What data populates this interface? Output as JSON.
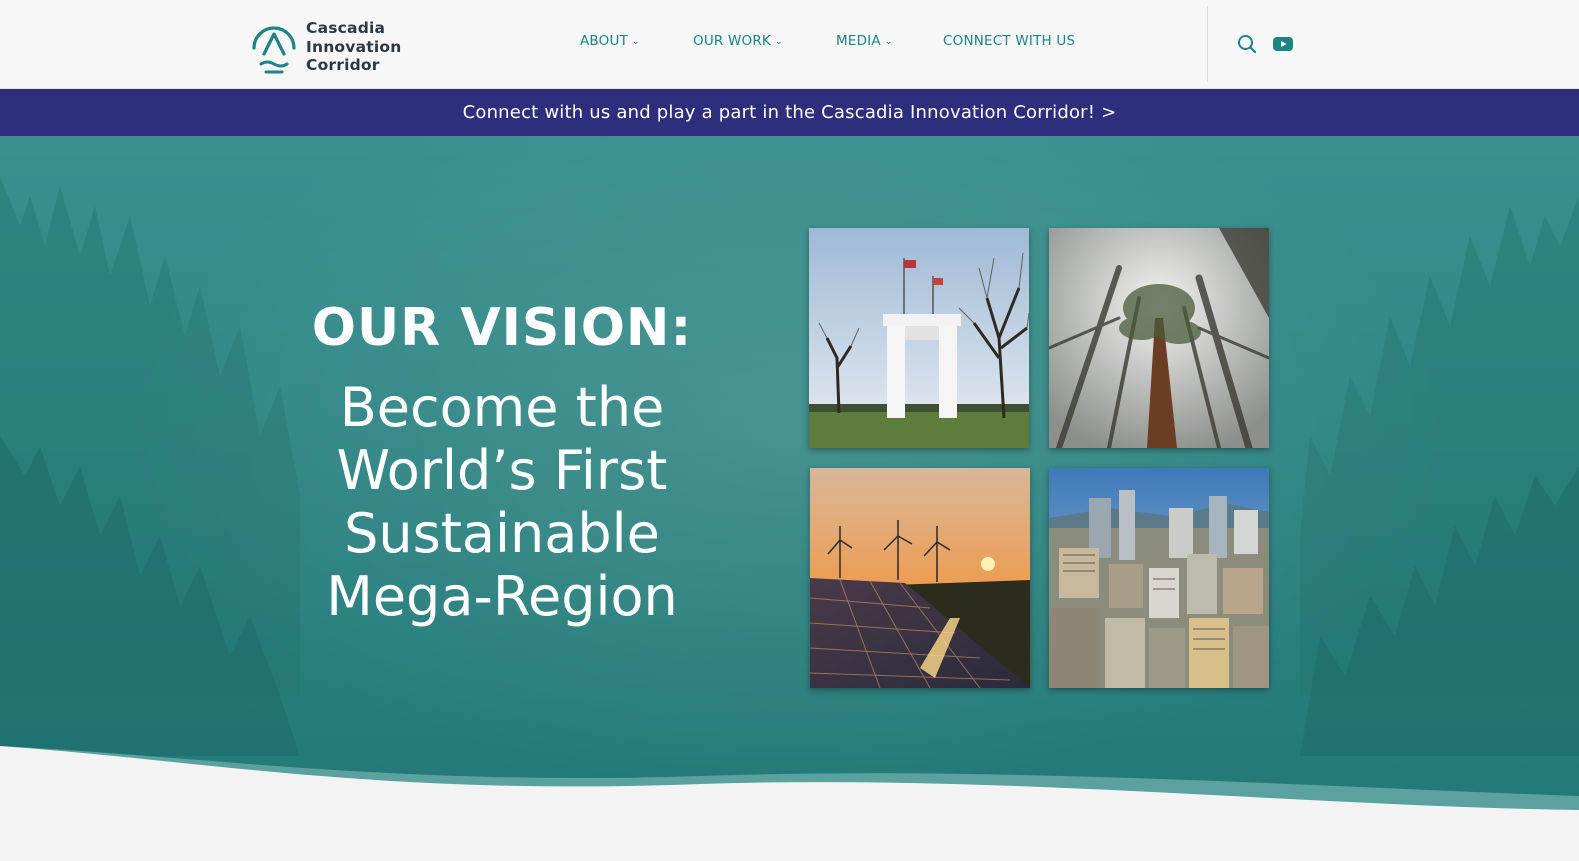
{
  "brand": {
    "line1": "Cascadia",
    "line2": "Innovation",
    "line3": "Corridor",
    "accent_color": "#1d8383",
    "banner_color": "#2d2f7d"
  },
  "nav": {
    "items": [
      {
        "label": "ABOUT",
        "has_dropdown": true
      },
      {
        "label": "OUR WORK",
        "has_dropdown": true
      },
      {
        "label": "MEDIA",
        "has_dropdown": true
      },
      {
        "label": "CONNECT WITH US",
        "has_dropdown": false
      }
    ],
    "chevron": "⌄"
  },
  "icons": {
    "search": "search-icon",
    "youtube": "youtube-icon"
  },
  "banner": {
    "text": "Connect with us and play a part in the Cascadia Innovation Corridor!  >"
  },
  "hero": {
    "heading": "OUR VISION:",
    "line1": "Become the",
    "line2": "World’s First",
    "line3": "Sustainable",
    "line4": "Mega-Region"
  }
}
